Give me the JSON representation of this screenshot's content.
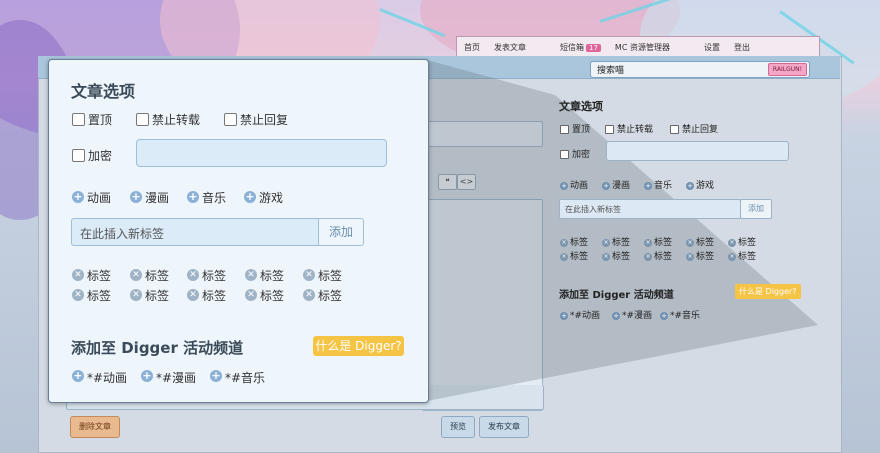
{
  "nav": {
    "items": [
      "首页",
      "发表文章",
      "短信箱",
      "MC 资源管理器",
      "设置",
      "登出"
    ],
    "inbox_count": "17"
  },
  "search": {
    "placeholder": "搜索喵",
    "button": "RAILGUN!"
  },
  "editor": {
    "delete_label": "删除文章",
    "preview_label": "预览",
    "publish_label": "发布文章",
    "quote_icon": "quote-icon",
    "code_icon": "code-icon"
  },
  "panel": {
    "title": "文章选项",
    "options": [
      "置顶",
      "禁止转载",
      "禁止回复"
    ],
    "encrypt_label": "加密",
    "categories": [
      "动画",
      "漫画",
      "音乐",
      "游戏"
    ],
    "tag_placeholder": "在此插入新标签",
    "add_label": "添加",
    "tags": [
      "标签",
      "标签",
      "标签",
      "标签",
      "标签",
      "标签",
      "标签",
      "标签",
      "标签",
      "标签"
    ],
    "digger_title": "添加至 Digger 活动频道",
    "digger_help": "什么是 Digger?",
    "channels": [
      "*#动画",
      "*#漫画",
      "*#音乐"
    ]
  }
}
